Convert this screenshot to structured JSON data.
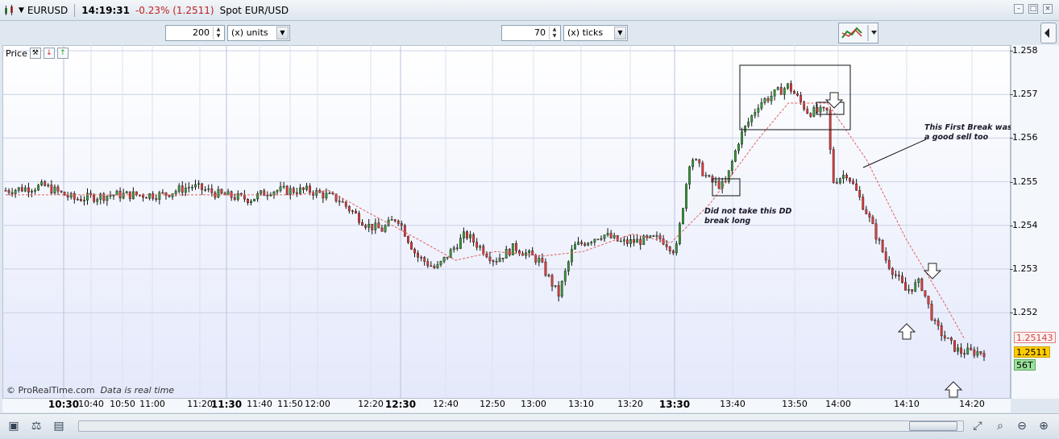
{
  "window": {
    "symbol": "EURUSD",
    "time": "14:19:31",
    "change": "-0.23% (1.2511)",
    "instrument": "Spot EUR/USD"
  },
  "toolbar": {
    "units_value": "200",
    "units_label": "(x) units",
    "ticks_value": "70",
    "ticks_label": "(x) ticks"
  },
  "panel": {
    "label": "Price"
  },
  "watermark": {
    "brand": "© ProRealTime.com",
    "status": "Data is real time"
  },
  "annotations": {
    "note1": "Did not take this DD\nbreak long",
    "note2": "This First Break was\na good sell too"
  },
  "tags": {
    "ma_value": "1.25143",
    "last_price": "1.2511",
    "bar_interval": "56T"
  },
  "colors": {
    "up_body": "#3a9a3a",
    "down_body": "#e03a3a",
    "ma_line": "#e06060",
    "last_price_bg": "#ffcc00",
    "interval_bg": "#9be29b"
  },
  "chart_data": {
    "type": "candlestick",
    "title": "EURUSD",
    "ylim": [
      1.2511,
      1.258
    ],
    "y_ticks": [
      "1.258",
      "1.257",
      "1.256",
      "1.255",
      "1.254",
      "1.253",
      "1.252"
    ],
    "x_ticks": [
      {
        "label": "10:30",
        "bold": true
      },
      {
        "label": "10:40"
      },
      {
        "label": "10:50"
      },
      {
        "label": "11:00"
      },
      {
        "label": "11:20"
      },
      {
        "label": "11:30",
        "bold": true
      },
      {
        "label": "11:40"
      },
      {
        "label": "11:50"
      },
      {
        "label": "12:00"
      },
      {
        "label": "12:20"
      },
      {
        "label": "12:30",
        "bold": true
      },
      {
        "label": "12:40"
      },
      {
        "label": "12:50"
      },
      {
        "label": "13:00"
      },
      {
        "label": "13:10"
      },
      {
        "label": "13:20"
      },
      {
        "label": "13:30",
        "bold": true
      },
      {
        "label": "13:40"
      },
      {
        "label": "13:50"
      },
      {
        "label": "14:00"
      },
      {
        "label": "14:10"
      },
      {
        "label": "14:20"
      }
    ],
    "price_path": [
      [
        0,
        1.2548
      ],
      [
        0.04,
        1.2549
      ],
      [
        0.07,
        1.2546
      ],
      [
        0.11,
        1.2547
      ],
      [
        0.16,
        1.2547
      ],
      [
        0.19,
        1.2549
      ],
      [
        0.22,
        1.2547
      ],
      [
        0.25,
        1.2546
      ],
      [
        0.27,
        1.2548
      ],
      [
        0.31,
        1.2548
      ],
      [
        0.34,
        1.2546
      ],
      [
        0.37,
        1.254
      ],
      [
        0.385,
        1.2539
      ],
      [
        0.4,
        1.2542
      ],
      [
        0.42,
        1.2533
      ],
      [
        0.44,
        1.253
      ],
      [
        0.47,
        1.2538
      ],
      [
        0.5,
        1.2532
      ],
      [
        0.52,
        1.2535
      ],
      [
        0.545,
        1.2532
      ],
      [
        0.565,
        1.2524
      ],
      [
        0.58,
        1.2535
      ],
      [
        0.61,
        1.2538
      ],
      [
        0.63,
        1.2536
      ],
      [
        0.67,
        1.2537
      ],
      [
        0.685,
        1.2534
      ],
      [
        0.7,
        1.2556
      ],
      [
        0.72,
        1.255
      ],
      [
        0.735,
        1.2549
      ],
      [
        0.75,
        1.256
      ],
      [
        0.77,
        1.2568
      ],
      [
        0.8,
        1.2572
      ],
      [
        0.82,
        1.2566
      ],
      [
        0.84,
        1.2566
      ],
      [
        0.845,
        1.255
      ],
      [
        0.86,
        1.2552
      ],
      [
        0.88,
        1.2543
      ],
      [
        0.9,
        1.2532
      ],
      [
        0.92,
        1.2525
      ],
      [
        0.935,
        1.2527
      ],
      [
        0.95,
        1.2517
      ],
      [
        0.965,
        1.2513
      ],
      [
        0.975,
        1.2511
      ]
    ],
    "moving_average": [
      [
        0,
        1.2547
      ],
      [
        0.12,
        1.2547
      ],
      [
        0.3,
        1.2547
      ],
      [
        0.33,
        1.2548
      ],
      [
        0.37,
        1.2543
      ],
      [
        0.42,
        1.2537
      ],
      [
        0.46,
        1.2532
      ],
      [
        0.5,
        1.2534
      ],
      [
        0.55,
        1.2533
      ],
      [
        0.59,
        1.2534
      ],
      [
        0.64,
        1.2538
      ],
      [
        0.68,
        1.2536
      ],
      [
        0.72,
        1.2545
      ],
      [
        0.77,
        1.256
      ],
      [
        0.8,
        1.2568
      ],
      [
        0.84,
        1.2568
      ],
      [
        0.88,
        1.2555
      ],
      [
        0.92,
        1.2537
      ],
      [
        0.96,
        1.2522
      ],
      [
        0.98,
        1.2514
      ]
    ]
  }
}
